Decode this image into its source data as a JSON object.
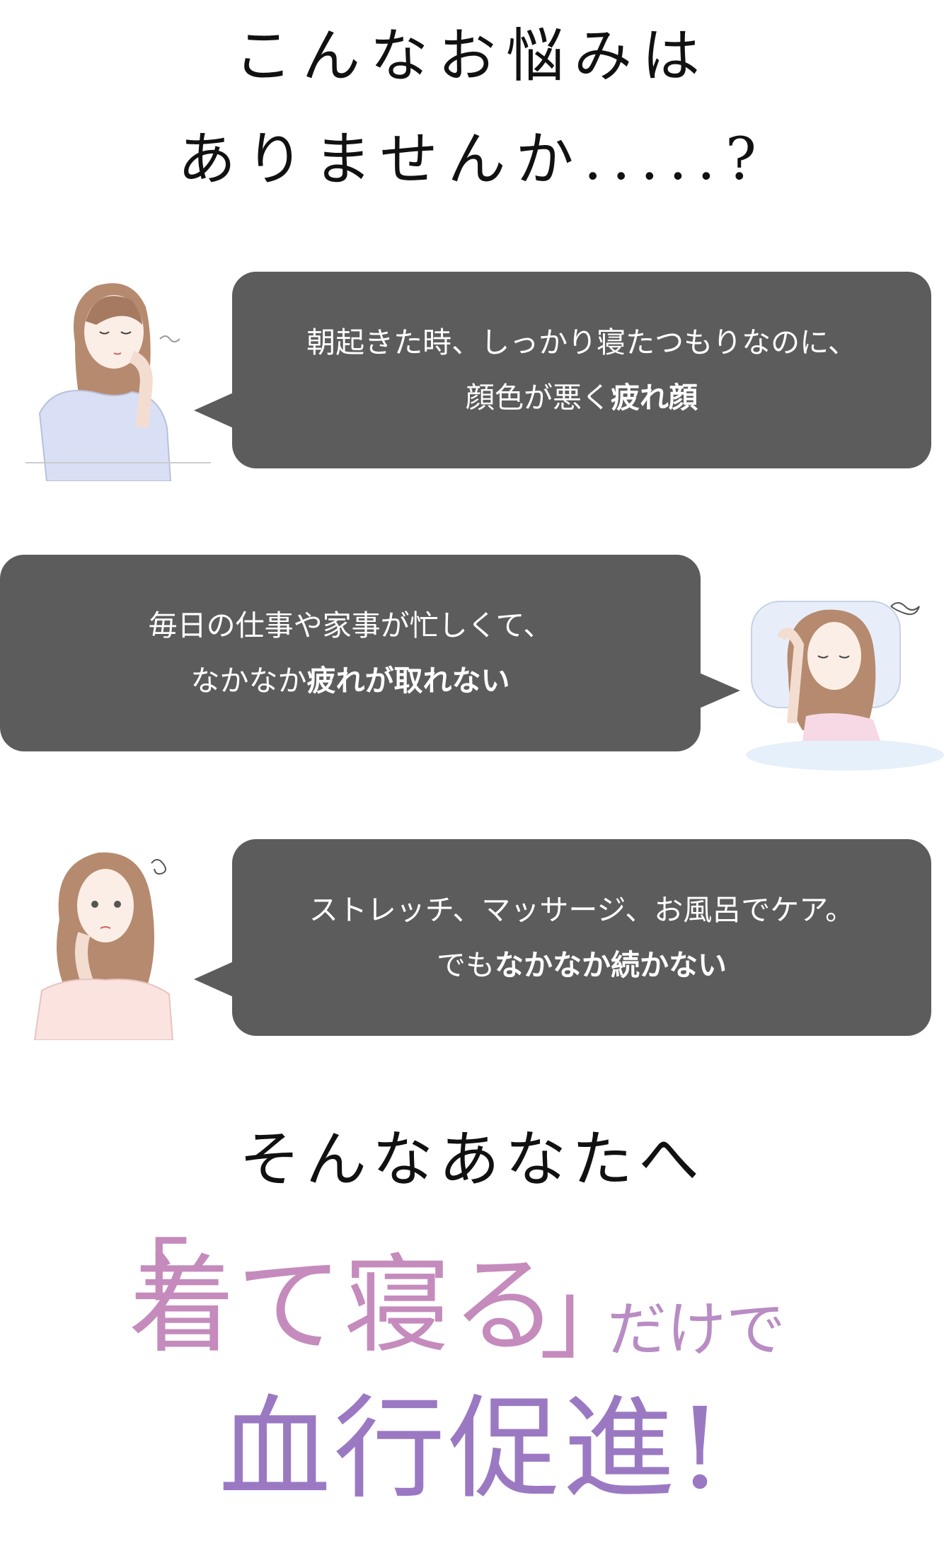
{
  "heading": {
    "line1": "こんなお悩みは",
    "line2": "ありませんか.....?"
  },
  "concerns": [
    {
      "line1": "朝起きた時、しっかり寝たつもりなのに、",
      "line2_plain": "顔色が悪く",
      "line2_bold": "疲れ顔"
    },
    {
      "line1": "毎日の仕事や家事が忙しくて、",
      "line2_plain": "なかなか",
      "line2_bold": "疲れが取れない"
    },
    {
      "line1": "ストレッチ、マッサージ、お風呂でケア。",
      "line2_plain": "でも",
      "line2_bold": "なかなか続かない"
    }
  ],
  "sub_heading": "そんなあなたへ",
  "catch": {
    "open": "「",
    "main": "着て寝る",
    "close": "」",
    "suffix": "だけで"
  },
  "main_heading": "血行促進!",
  "colors": {
    "bubble": "#5c5c5c",
    "catch_pink": "#c58bbd",
    "main_purple": "#9b79c2"
  }
}
